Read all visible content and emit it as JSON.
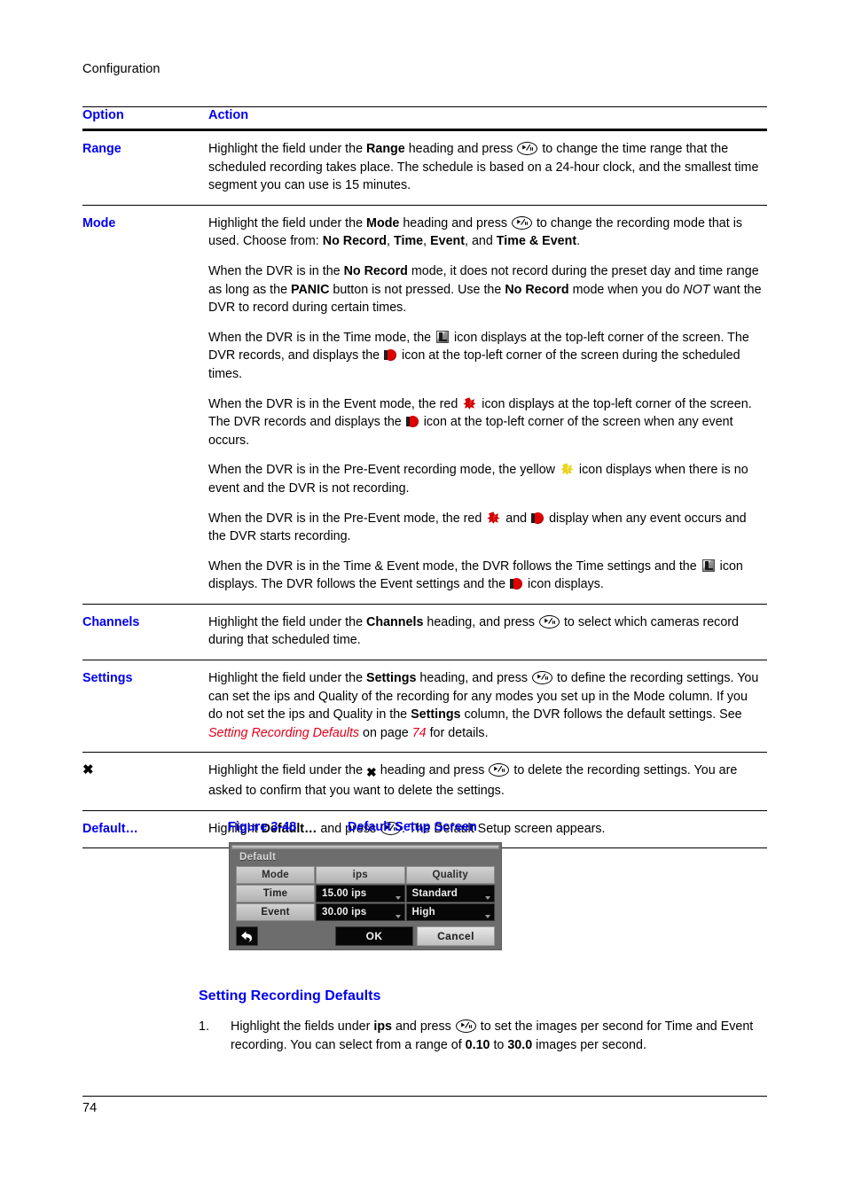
{
  "page": {
    "running_header": "Configuration",
    "folio": "74"
  },
  "table": {
    "headers": {
      "option": "Option",
      "action": "Action"
    },
    "rows": [
      {
        "option": "Range",
        "option_kind": "text",
        "paragraphs": [
          "Highlight the field under the <b>Range</b> heading and press <enter> to change the time range that the scheduled recording takes place. The schedule is based on a 24-hour clock, and the smallest time segment you can use is 15 minutes."
        ]
      },
      {
        "option": "Mode",
        "option_kind": "text",
        "paragraphs": [
          "Highlight the field under the <b>Mode</b> heading and press <enter> to change the recording mode that is used. Choose from: <b>No Record</b>, <b>Time</b>, <b>Event</b>, and <b>Time &amp; Event</b>.",
          "When the DVR is in the <b>No Record</b> mode, it does not record during the preset day and time range as long as the <b>PANIC</b> button is not pressed. Use the <b>No Record</b> mode when you do <i>NOT</i> want the DVR to record during certain times.",
          "When the DVR is in the Time mode, the <time-icon> icon displays at the top-left corner of the screen. The DVR records, and displays the <record-icon> icon at the top-left corner of the screen during the scheduled times.",
          "When the DVR is in the Event mode, the red <event-red-icon> icon displays at the top-left corner of the screen. The DVR records and displays the <record-icon> icon at the top-left corner of the screen when any event occurs.",
          "When the DVR is in the Pre-Event recording mode, the yellow <event-yellow-icon> icon displays when there is no event and the DVR is not recording.",
          "When the DVR is in the Pre-Event mode, the red <event-red-icon> and <record-icon> display when any event occurs and the DVR starts recording.",
          "When the DVR is in the Time &amp; Event mode, the DVR follows the Time settings and the <time-icon> icon displays. The DVR follows the Event settings and the <record-icon> icon displays."
        ]
      },
      {
        "option": "Channels",
        "option_kind": "text",
        "paragraphs": [
          "Highlight the field under the <b>Channels</b> heading, and press <enter> to select which cameras record during that scheduled time."
        ]
      },
      {
        "option": "Settings",
        "option_kind": "text",
        "paragraphs": [
          "Highlight the field under the <b>Settings</b> heading, and press <enter> to define the recording settings. You can set the ips and Quality of the recording for any modes you set up in the Mode column. If you do not set the ips and Quality in the <b>Settings</b> column, the DVR follows the default settings. See <xref>Setting Recording Defaults</xref> on page <xref>74</xref> for details."
        ]
      },
      {
        "option": "✖",
        "option_kind": "symbol",
        "paragraphs": [
          "Highlight the field under the <x-icon> heading and press <enter> to delete the recording settings. You are asked to confirm that you want to delete the settings."
        ]
      },
      {
        "option": "Default…",
        "option_kind": "text",
        "paragraphs": [
          "Highlight <b>Default…</b> and press <enter>. The Default Setup screen appears."
        ]
      }
    ]
  },
  "figure": {
    "number": "Figure 3-48",
    "title": "Default Setup Screen",
    "dialog": {
      "title": "Default",
      "columns": [
        "Mode",
        "ips",
        "Quality"
      ],
      "rows": [
        {
          "mode": "Time",
          "ips": "15.00 ips",
          "quality": "Standard"
        },
        {
          "mode": "Event",
          "ips": "30.00 ips",
          "quality": "High"
        }
      ],
      "back_icon": "back-arrow-icon",
      "ok_label": "OK",
      "cancel_label": "Cancel"
    }
  },
  "section": {
    "heading": "Setting Recording Defaults",
    "items": [
      {
        "number": "1.",
        "text": "Highlight the fields under <b>ips</b> and press <enter> to set the images per second for Time and Event recording. You can select from a range of <b>0.10</b> to <b>30.0</b> images per second."
      }
    ]
  },
  "colors": {
    "link_blue": "#0000ee",
    "xref_red": "#e2001a",
    "record_red": "#e00000",
    "event_yellow": "#e8d320"
  }
}
